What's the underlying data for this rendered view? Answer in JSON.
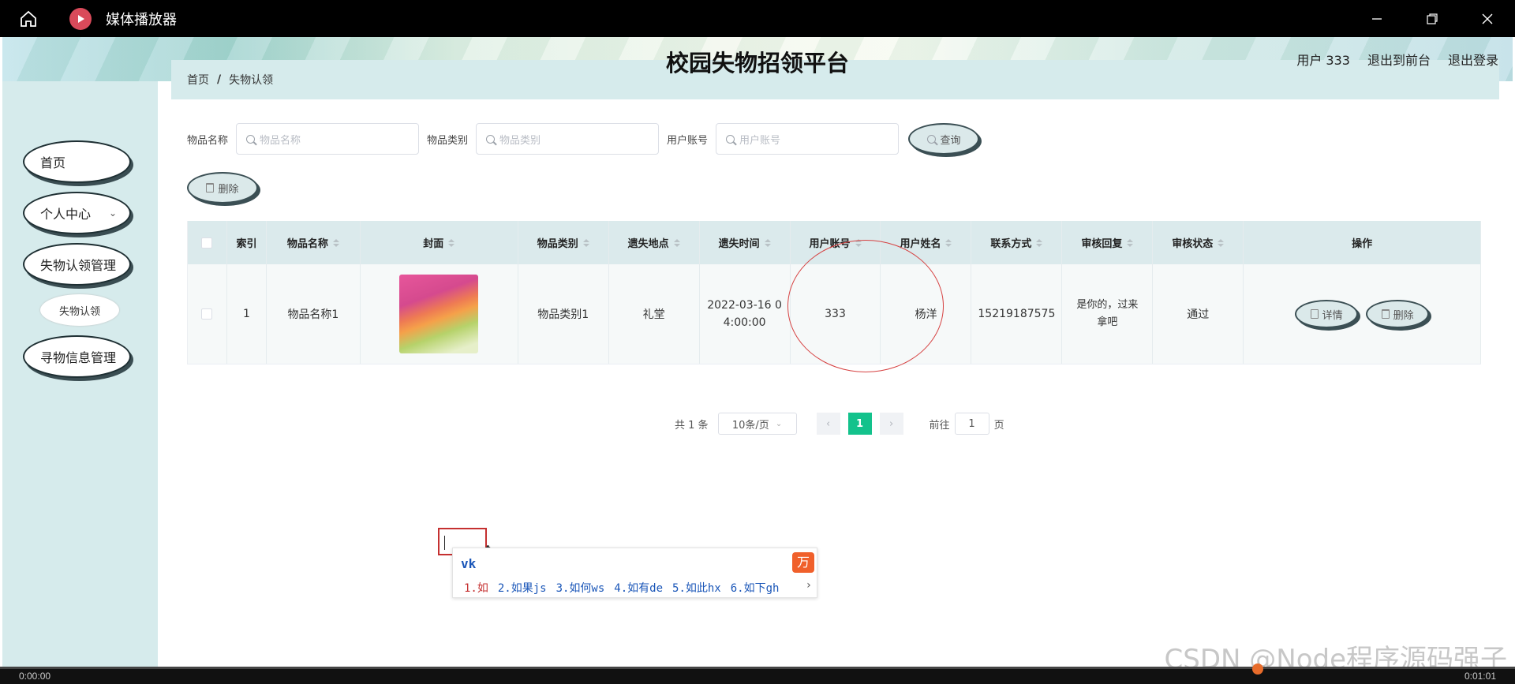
{
  "player": {
    "title": "媒体播放器",
    "time_left": "0:00:00",
    "time_right": "0:01:01",
    "progress": 0.83
  },
  "header": {
    "site_title": "校园失物招领平台",
    "user_label": "用户 333",
    "goto_front": "退出到前台",
    "logout": "退出登录"
  },
  "sidebar": {
    "items": [
      {
        "label": "首页"
      },
      {
        "label": "个人中心"
      },
      {
        "label": "失物认领管理"
      },
      {
        "label": "失物认领"
      },
      {
        "label": "寻物信息管理"
      }
    ]
  },
  "breadcrumb": {
    "home": "首页",
    "sep": "/",
    "current": "失物认领"
  },
  "search": {
    "name_label": "物品名称",
    "name_placeholder": "物品名称",
    "type_label": "物品类别",
    "type_placeholder": "物品类别",
    "account_label": "用户账号",
    "account_placeholder": "用户账号",
    "query_button": "查询"
  },
  "toolbar": {
    "delete_button": "删除"
  },
  "table": {
    "headers": [
      "索引",
      "物品名称",
      "封面",
      "物品类别",
      "遗失地点",
      "遗失时间",
      "用户账号",
      "用户姓名",
      "联系方式",
      "审核回复",
      "审核状态",
      "操作"
    ],
    "rows": [
      {
        "index": "1",
        "name": "物品名称1",
        "type": "物品类别1",
        "place": "礼堂",
        "time_line1": "2022-03-16 0",
        "time_line2": "4:00:00",
        "account": "333",
        "username": "杨洋",
        "phone": "15219187575",
        "reply_line1": "是你的，过来",
        "reply_line2": "拿吧",
        "status": "通过",
        "detail_button": "详情",
        "delete_button": "删除"
      }
    ]
  },
  "pagination": {
    "total": "共 1 条",
    "page_size": "10条/页",
    "current_page": "1",
    "goto_label": "前往",
    "goto_value": "1",
    "page_suffix": "页"
  },
  "ime": {
    "composition": "vk",
    "candidates": [
      "1.如",
      "2.如果js",
      "3.如何ws",
      "4.如有de",
      "5.如此hx",
      "6.如下gh"
    ],
    "logo": "万"
  },
  "watermark": "CSDN @Node程序源码强子",
  "colors": {
    "accent": "#13c28c",
    "sidebar_bg": "#d6ebec",
    "annotation_red": "#d64141"
  }
}
